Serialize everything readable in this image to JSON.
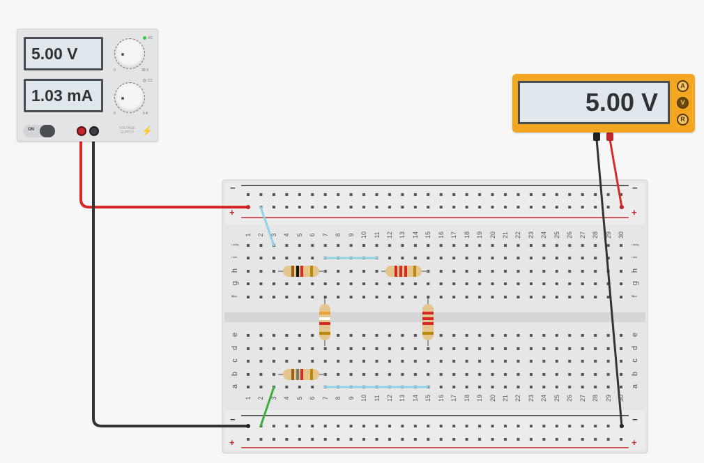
{
  "power_supply": {
    "voltage_display": "5.00 V",
    "current_display": "1.03 mA",
    "voltage_knob_min": "0",
    "voltage_knob_max": "30 V",
    "current_knob_min": "0",
    "current_knob_max": "5 A",
    "cv_label": "VC",
    "cc_label": "CC",
    "switch_label": "ON",
    "brand_line1": "VOLTAGE",
    "brand_line2": "SUPPLY",
    "cv_led_color": "#2ecc40",
    "cc_led_color": "#c8cbcf"
  },
  "multimeter": {
    "display": "5.00 V",
    "mode_buttons": [
      "A",
      "V",
      "R"
    ],
    "active_mode": "V"
  },
  "breadboard": {
    "columns": [
      "1",
      "2",
      "3",
      "4",
      "5",
      "6",
      "7",
      "8",
      "9",
      "10",
      "11",
      "12",
      "13",
      "14",
      "15",
      "16",
      "17",
      "18",
      "19",
      "20",
      "21",
      "22",
      "23",
      "24",
      "25",
      "26",
      "27",
      "28",
      "29",
      "30"
    ],
    "top_rows": [
      "j",
      "i",
      "h",
      "g",
      "f"
    ],
    "bottom_rows": [
      "e",
      "d",
      "c",
      "b",
      "a"
    ],
    "rail_minus": "−",
    "rail_plus": "+"
  },
  "colors": {
    "wire_red": "#d62a2a",
    "wire_black": "#333333",
    "wire_blue": "#8fd3e6",
    "wire_green": "#3cae3c",
    "rail_red": "#c0272d",
    "rail_black": "#2c2c2c"
  }
}
